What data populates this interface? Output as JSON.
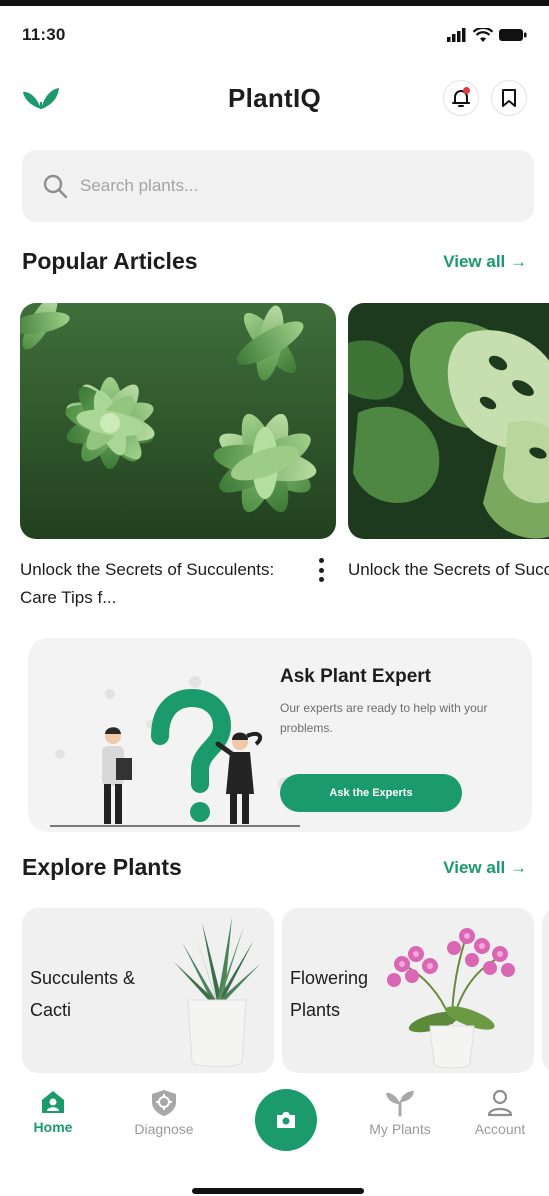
{
  "status_bar": {
    "time": "11:30"
  },
  "header": {
    "title": "PlantIQ",
    "logo_icon": "leaf-icon",
    "notification_icon": "bell-icon",
    "bookmark_icon": "bookmark-icon"
  },
  "search": {
    "placeholder": "Search plants...",
    "value": ""
  },
  "popular_articles": {
    "title": "Popular Articles",
    "view_all": "View all →",
    "items": [
      {
        "caption": "Unlock the Secrets of Succulents: Care Tips f...",
        "image": "succulent-photo"
      },
      {
        "caption": "Unlock the Secrets of Succulents: Care Tips",
        "image": "monstera-photo"
      }
    ]
  },
  "expert_card": {
    "title": "Ask Plant Expert",
    "description": "Our experts are ready to help with your problems.",
    "button": "Ask the Experts"
  },
  "explore_plants": {
    "title": "Explore Plants",
    "view_all": "View all →",
    "items": [
      {
        "label": "Succulents & Cacti",
        "image": "potted-snake-plant"
      },
      {
        "label": "Flowering Plants",
        "image": "potted-orchid"
      }
    ]
  },
  "bottom_nav": {
    "items": [
      {
        "label": "Home",
        "icon": "home-icon",
        "active": true
      },
      {
        "label": "Diagnose",
        "icon": "shield-icon",
        "active": false
      },
      {
        "label": "",
        "icon": "camera-icon",
        "active": false
      },
      {
        "label": "My Plants",
        "icon": "sprout-icon",
        "active": false
      },
      {
        "label": "Account",
        "icon": "user-icon",
        "active": false
      }
    ]
  },
  "colors": {
    "accent": "#1b9a6c",
    "card_bg": "#f3f3f3",
    "text": "#1c1c1c",
    "muted": "#9a9a9a"
  }
}
